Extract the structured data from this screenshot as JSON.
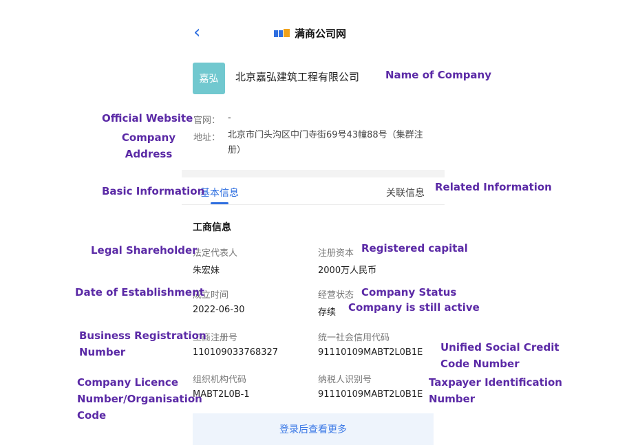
{
  "header": {
    "back_icon": "chevron-left-icon",
    "logo_text": "满商公司网"
  },
  "company": {
    "avatar_text": "嘉弘",
    "name": "北京嘉弘建筑工程有限公司",
    "website_label": "官网：",
    "website_value": "-",
    "address_label": "地址：",
    "address_value": "北京市门头沟区中门寺街69号43幢88号（集群注册）"
  },
  "tabs": {
    "basic": "基本信息",
    "related": "关联信息"
  },
  "section": {
    "title": "工商信息",
    "fields": [
      {
        "label": "法定代表人",
        "value": "朱宏妹"
      },
      {
        "label": "注册资本",
        "value": "2000万人民币"
      },
      {
        "label": "成立时间",
        "value": "2022-06-30"
      },
      {
        "label": "经营状态",
        "value": "存续"
      },
      {
        "label": "工商注册号",
        "value": "110109033768327"
      },
      {
        "label": "统一社会信用代码",
        "value": "91110109MABT2L0B1E"
      },
      {
        "label": "组织机构代码",
        "value": "MABT2L0B-1"
      },
      {
        "label": "纳税人识别号",
        "value": "91110109MABT2L0B1E"
      }
    ]
  },
  "cta": {
    "label": "登录后查看更多"
  },
  "annotations": {
    "name_of_company": "Name of Company",
    "official_website": "Official Website",
    "company_address": "Company\nAddress",
    "basic_information": "Basic Information",
    "related_information": "Related Information",
    "legal_shareholder": "Legal Shareholder",
    "registered_capital": "Registered capital",
    "date_of_establishment": "Date of Establishment",
    "company_status": "Company Status",
    "company_active": "Company is still active",
    "business_registration_number": "Business Registration\nNumber",
    "unified_social_credit": "Unified Social Credit\nCode Number",
    "company_licence": "Company Licence\nNumber/Organisation\nCode",
    "taxpayer_id": "Taxpayer Identification\nNumber"
  },
  "colors": {
    "accent": "#2f6fe0",
    "annotation": "#5b2aa6",
    "avatar_bg": "#71c8cf"
  }
}
